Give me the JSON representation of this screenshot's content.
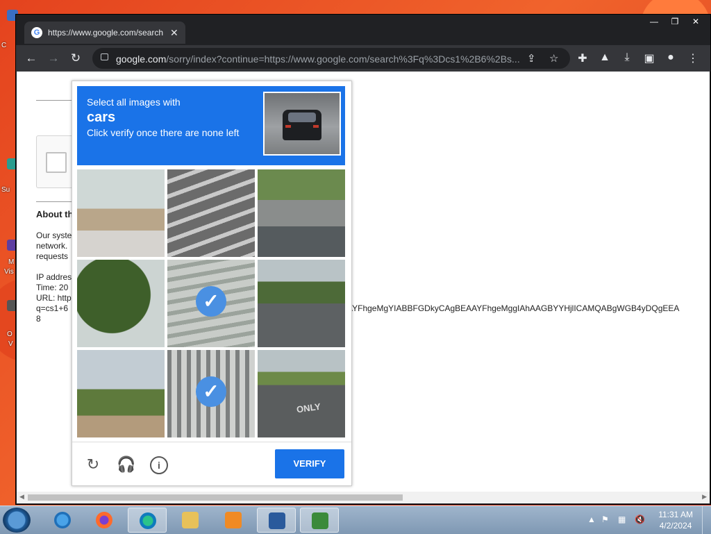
{
  "browser": {
    "tab_title": "https://www.google.com/search",
    "url_host": "google.com",
    "url_rest": "/sorry/index?continue=https://www.google.com/search%3Fq%3Dcs1%2B6%2Bs..."
  },
  "page": {
    "about_heading": "About th",
    "line1": "Our syste",
    "line2": "network.",
    "line3": "requests",
    "ip_line": "IP addres",
    "time_line": "Time: 20",
    "url_line": "URL: http",
    "q_line": "q=cs1+6",
    "digit_line": "8",
    "long_token": "AYFhgeMgYIABBFGDkyCAgBEAAYFhgeMggIAhAAGBYYHjlICAMQABgWGB4yDQgEEA"
  },
  "captcha": {
    "instruction": "Select all images with",
    "object": "cars",
    "hint": "Click verify once there are none left",
    "verify_label": "VERIFY",
    "tile_text_only": "ONLY",
    "tiles": [
      {
        "selected": false
      },
      {
        "selected": false
      },
      {
        "selected": false
      },
      {
        "selected": false
      },
      {
        "selected": true
      },
      {
        "selected": false
      },
      {
        "selected": false
      },
      {
        "selected": true
      },
      {
        "selected": false
      }
    ]
  },
  "taskbar": {
    "time": "11:31 AM",
    "date": "4/2/2024"
  },
  "desktop": {
    "label1": "C",
    "label2": "Su",
    "label3": "M",
    "label3b": "Vis",
    "label4": "O",
    "label4b": "V"
  },
  "colors": {
    "accent": "#1a73e8",
    "checkmark": "#4a90e2",
    "browser_frame": "#202124"
  }
}
